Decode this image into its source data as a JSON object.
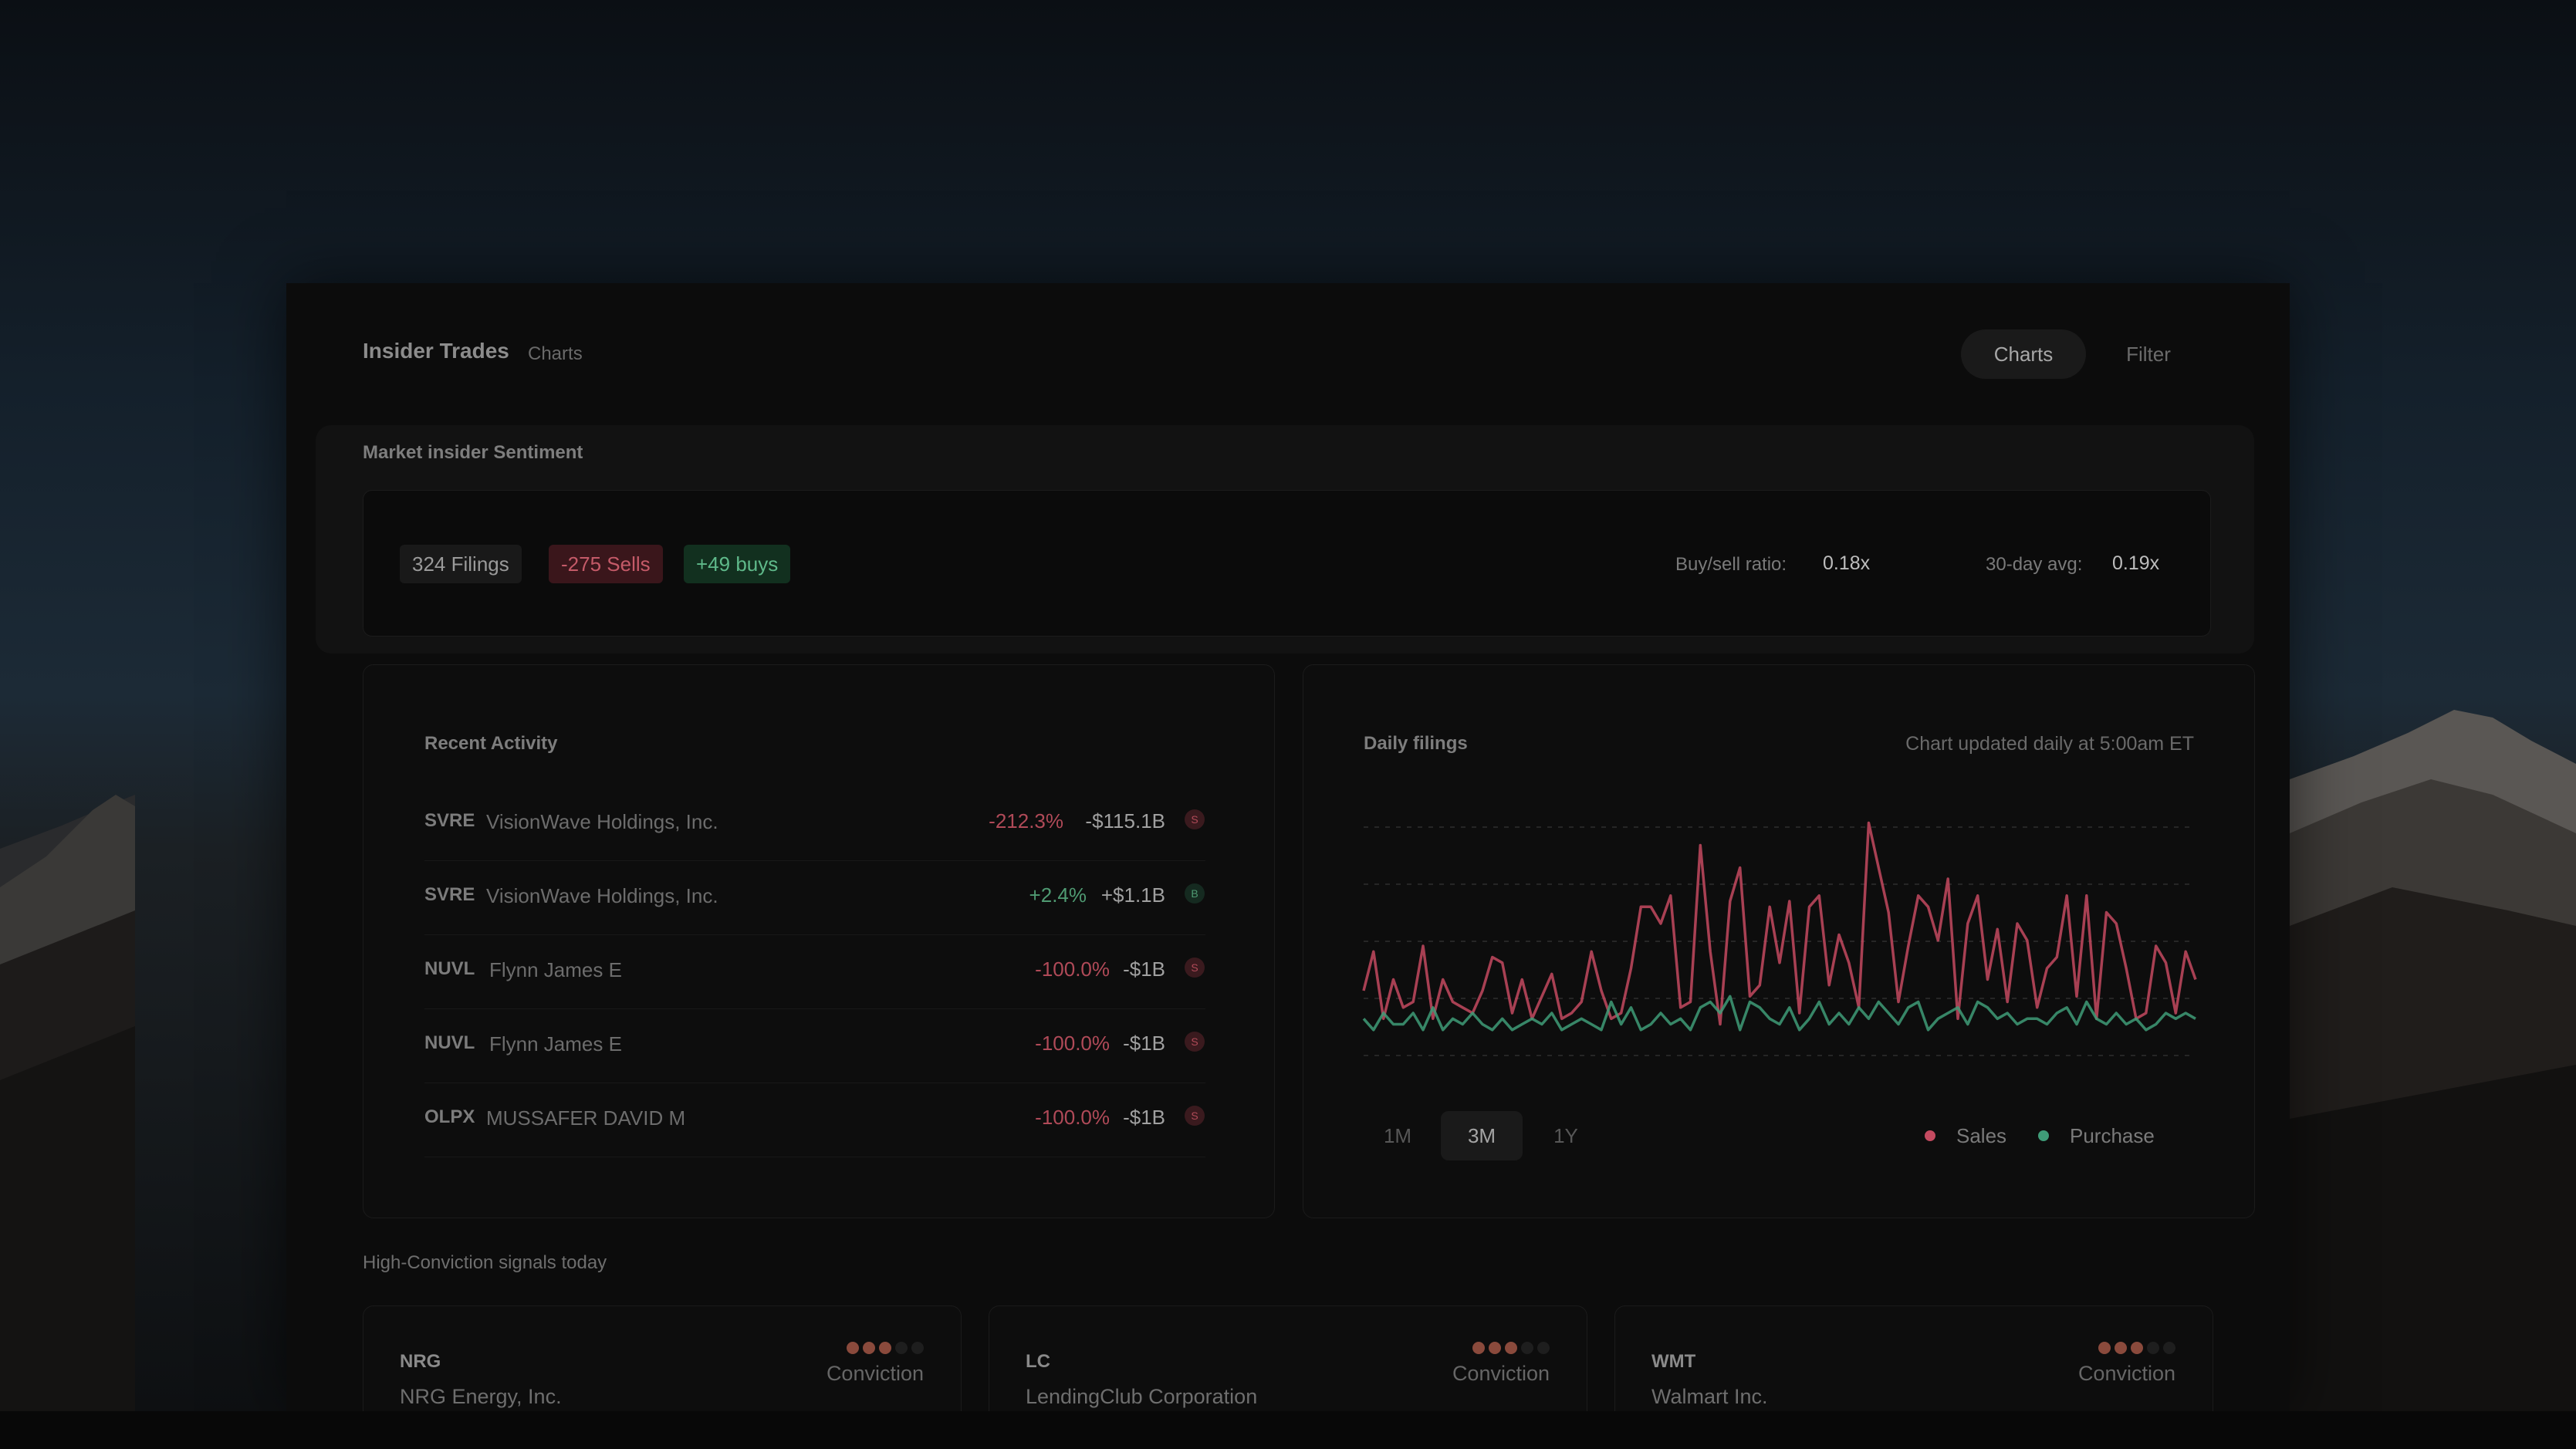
{
  "header": {
    "title": "Insider Trades",
    "subtitle": "Charts",
    "tabs": [
      {
        "label": "Charts",
        "active": true
      },
      {
        "label": "Filter",
        "active": false
      }
    ]
  },
  "sentiment": {
    "title": "Market insider Sentiment",
    "filings": "324 Filings",
    "sells": "-275 Sells",
    "buys": "+49 buys",
    "ratio_label": "Buy/sell ratio:",
    "ratio_value": "0.18x",
    "avg_label": "30-day avg:",
    "avg_value": "0.19x"
  },
  "activity": {
    "title": "Recent Activity",
    "rows": [
      {
        "ticker": "SVRE",
        "name": "VisionWave Holdings, Inc.",
        "pct": "-212.3%",
        "amount": "-$115.1B",
        "badge": "S",
        "direction": "neg"
      },
      {
        "ticker": "SVRE",
        "name": "VisionWave Holdings, Inc.",
        "pct": "+2.4%",
        "amount": "+$1.1B",
        "badge": "B",
        "direction": "pos"
      },
      {
        "ticker": "NUVL",
        "name": "Flynn James E",
        "pct": "-100.0%",
        "amount": "-$1B",
        "badge": "S",
        "direction": "neg"
      },
      {
        "ticker": "NUVL",
        "name": "Flynn James E",
        "pct": "-100.0%",
        "amount": "-$1B",
        "badge": "S",
        "direction": "neg"
      },
      {
        "ticker": "OLPX",
        "name": "MUSSAFER DAVID M",
        "pct": "-100.0%",
        "amount": "-$1B",
        "badge": "S",
        "direction": "neg"
      }
    ]
  },
  "daily_chart": {
    "title": "Daily filings",
    "note": "Chart updated daily at 5:00am ET",
    "ranges": [
      {
        "label": "1M",
        "active": false
      },
      {
        "label": "3M",
        "active": true
      },
      {
        "label": "1Y",
        "active": false
      }
    ],
    "legend": [
      {
        "label": "Sales",
        "color": "#c44a60"
      },
      {
        "label": "Purchase",
        "color": "#3f9c78"
      }
    ]
  },
  "chart_data": {
    "type": "line",
    "title": "Daily filings",
    "xlabel": "",
    "ylabel": "",
    "ylim": [
      0,
      40
    ],
    "grid": true,
    "legend_position": "bottom-right",
    "series": [
      {
        "name": "Sales",
        "color": "#c44a60",
        "values": [
          8,
          15,
          3,
          10,
          5,
          6,
          16,
          3,
          10,
          6,
          5,
          4,
          8,
          14,
          13,
          4,
          10,
          3,
          7,
          11,
          3,
          4,
          6,
          15,
          8,
          3,
          4,
          12,
          23,
          23,
          20,
          25,
          5,
          6,
          34,
          15,
          2,
          24,
          30,
          7,
          9,
          23,
          13,
          24,
          4,
          23,
          25,
          9,
          18,
          13,
          5,
          38,
          30,
          22,
          6,
          16,
          25,
          23,
          17,
          28,
          3,
          20,
          25,
          10,
          19,
          6,
          20,
          17,
          5,
          12,
          14,
          25,
          7,
          25,
          3,
          22,
          20,
          12,
          3,
          4,
          16,
          13,
          4,
          15,
          10
        ]
      },
      {
        "name": "Purchase",
        "color": "#3f9c78",
        "values": [
          3,
          1,
          4,
          2,
          2,
          4,
          1,
          5,
          1,
          3,
          2,
          4,
          2,
          1,
          3,
          1,
          2,
          3,
          2,
          4,
          1,
          2,
          3,
          2,
          1,
          6,
          2,
          5,
          1,
          2,
          4,
          2,
          3,
          1,
          5,
          6,
          4,
          7,
          1,
          6,
          5,
          3,
          2,
          5,
          1,
          3,
          6,
          2,
          4,
          2,
          5,
          3,
          6,
          4,
          2,
          5,
          6,
          1,
          3,
          4,
          5,
          2,
          6,
          5,
          3,
          4,
          2,
          3,
          3,
          2,
          4,
          5,
          2,
          6,
          3,
          2,
          4,
          2,
          3,
          1,
          2,
          4,
          3,
          4,
          3
        ]
      }
    ]
  },
  "signals": {
    "title": "High-Conviction signals today",
    "cards": [
      {
        "ticker": "NRG",
        "name": "NRG Energy, Inc.",
        "conviction_label": "Conviction",
        "level": 3,
        "max": 5
      },
      {
        "ticker": "LC",
        "name": "LendingClub Corporation",
        "conviction_label": "Conviction",
        "level": 3,
        "max": 5
      },
      {
        "ticker": "WMT",
        "name": "Walmart Inc.",
        "conviction_label": "Conviction",
        "level": 3,
        "max": 5
      }
    ]
  }
}
